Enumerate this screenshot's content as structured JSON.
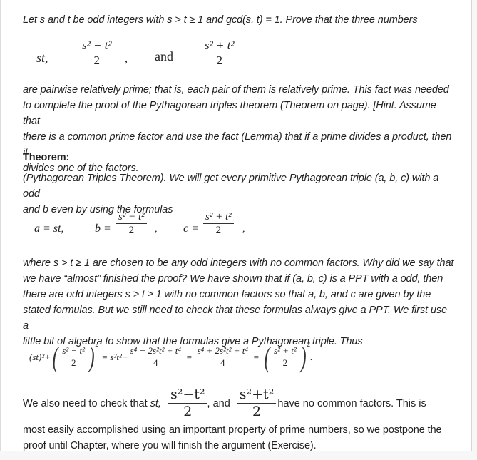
{
  "problem": {
    "intro": "Let s and t be odd integers with s > t ≥ 1 and gcd(s, t) = 1. Prove that the three numbers",
    "display1": {
      "term1": "st,",
      "frac1_num": "s² − t²",
      "frac1_den": "2",
      "comma": ",",
      "and": "and",
      "frac2_num": "s² + t²",
      "frac2_den": "2"
    },
    "body_lines": [
      "are pairwise relatively prime; that is, each pair of them is relatively prime. This fact was needed",
      "to complete the proof of the Pythagorean triples theorem (Theorem on page). [Hint. Assume that",
      "there is a common prime factor and use the fact (Lemma) that if a prime divides a product, then it",
      "divides one of the factors."
    ]
  },
  "theorem": {
    "heading": "Theorem:",
    "lines": [
      "(Pythagorean Triples Theorem). We will get every primitive Pythagorean triple (a, b, c) with a odd",
      "and b even by using the formulas"
    ],
    "formulas": {
      "a": "a = st,",
      "b_lhs": "b =",
      "b_num": "s² − t²",
      "b_den": "2",
      "c_lhs": "c =",
      "c_num": "s² + t²",
      "c_den": "2",
      "comma": ","
    },
    "after_lines": [
      "where s > t ≥ 1 are chosen to be any odd integers with no common factors. Why did we say that",
      "we have “almost” finished the proof? We have shown that if (a, b, c) is a PPT with a odd, then",
      "there are odd integers s > t ≥ 1 with no common factors so that a, b, and c are given by the",
      "stated formulas. But we still need to check that these formulas always give a PPT. We first use a",
      "little bit of algebra to show that the formulas give a Pythagorean triple. Thus"
    ]
  },
  "equation": {
    "t1": "(st)²+",
    "f1_num": "s² − t²",
    "f1_den": "2",
    "exp": "2",
    "eq1": "= s²t²+",
    "f2_num": "s⁴ − 2s²t² + t⁴",
    "f2_den": "4",
    "eq2": "=",
    "f3_num": "s⁴ + 2s²t² + t⁴",
    "f3_den": "4",
    "eq3": "=",
    "f4_num": "s² + t²",
    "f4_den": "2",
    "end": "."
  },
  "closing": {
    "pre": "We also need to check that",
    "st": "st,",
    "f1_num": "s²−t²",
    "f1_den": "2",
    "and": ", and",
    "f2_num": "s²+t²",
    "f2_den": "2",
    "post": "have no common factors. This is",
    "lines": [
      "most easily accomplished using an important property of prime numbers, so we postpone the",
      "proof until Chapter, where you will finish the argument (Exercise)."
    ]
  }
}
